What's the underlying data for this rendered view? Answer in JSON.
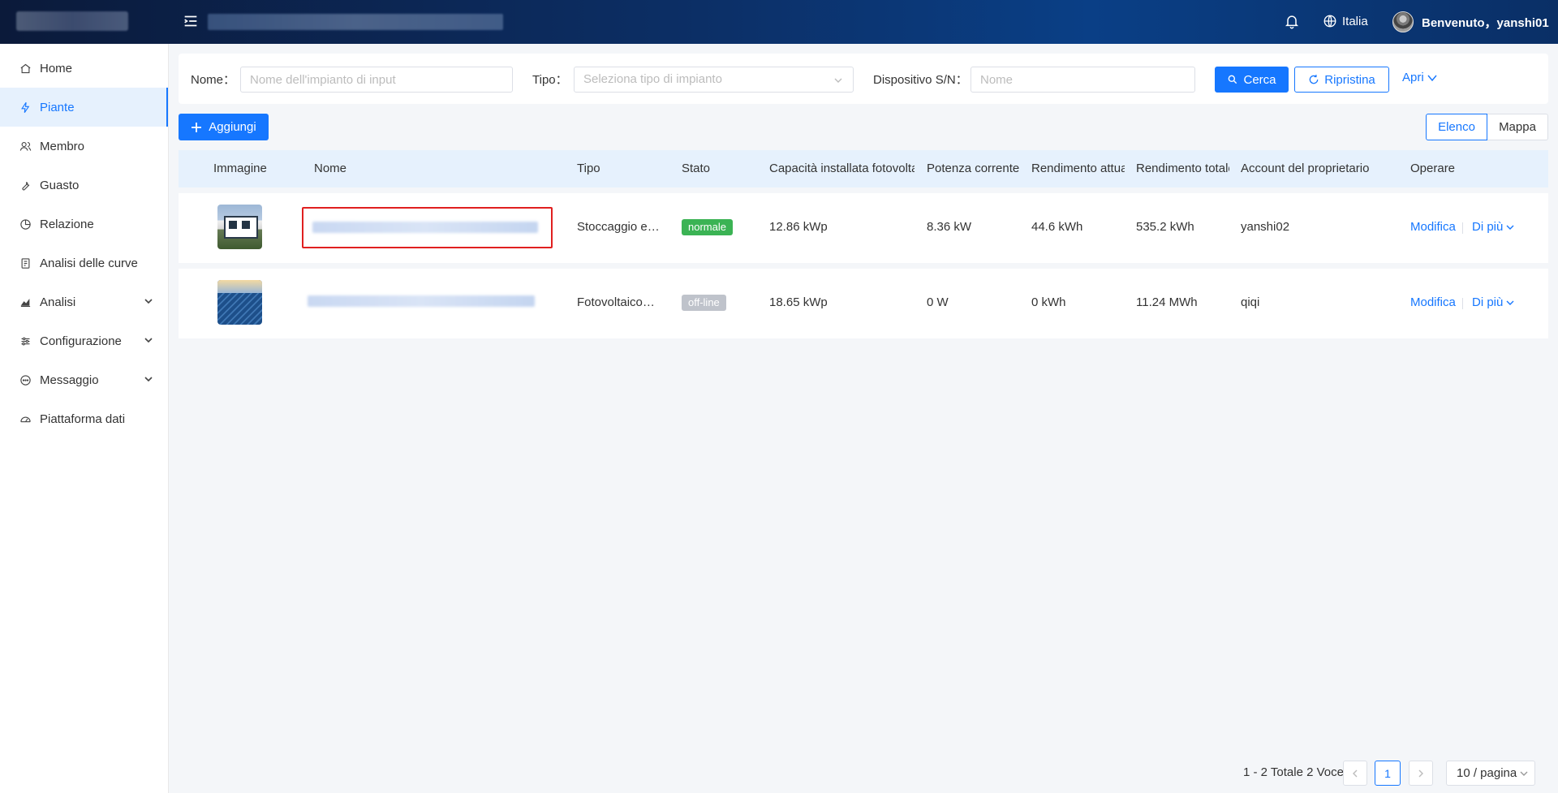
{
  "header": {
    "language": "Italia",
    "welcome": "Benvenuto，yanshi01"
  },
  "sidebar": {
    "items": [
      {
        "label": "Home",
        "icon": "home-icon"
      },
      {
        "label": "Piante",
        "icon": "lightning-icon",
        "active": true
      },
      {
        "label": "Membro",
        "icon": "users-icon"
      },
      {
        "label": "Guasto",
        "icon": "wrench-icon"
      },
      {
        "label": "Relazione",
        "icon": "pie-chart-icon"
      },
      {
        "label": "Analisi delle curve",
        "icon": "report-icon"
      },
      {
        "label": "Analisi",
        "icon": "area-chart-icon",
        "expandable": true
      },
      {
        "label": "Configurazione",
        "icon": "sliders-icon",
        "expandable": true
      },
      {
        "label": "Messaggio",
        "icon": "message-icon",
        "expandable": true
      },
      {
        "label": "Piattaforma dati",
        "icon": "dashboard-icon"
      }
    ]
  },
  "filter": {
    "name_label": "Nome",
    "name_placeholder": "Nome dell'impianto di input",
    "type_label": "Tipo",
    "type_placeholder": "Seleziona tipo di impianto",
    "sn_label": "Dispositivo S/N",
    "sn_placeholder": "Nome",
    "search_label": "Cerca",
    "reset_label": "Ripristina",
    "expand_label": "Apri"
  },
  "toolbar": {
    "add_label": "Aggiungi",
    "view_list": "Elenco",
    "view_map": "Mappa"
  },
  "table": {
    "columns": [
      "Immagine",
      "Nome",
      "Tipo",
      "Stato",
      "Capacità installata fotovoltaica",
      "Potenza corrente",
      "Rendimento attuale",
      "Rendimento totale",
      "Account del proprietario",
      "Operare"
    ],
    "rows": [
      {
        "type": "Stoccaggio e…",
        "status": "normale",
        "status_color": "#3bb354",
        "capacity": "12.86 kWp",
        "power": "8.36 kW",
        "current_yield": "44.6 kWh",
        "total_yield": "535.2 kWh",
        "owner": "yanshi02",
        "edit": "Modifica",
        "more": "Di più"
      },
      {
        "type": "Fotovoltaico…",
        "status": "off-line",
        "status_color": "#bfc3cb",
        "capacity": "18.65 kWp",
        "power": "0 W",
        "current_yield": "0 kWh",
        "total_yield": "11.24 MWh",
        "owner": "qiqi",
        "edit": "Modifica",
        "more": "Di più"
      }
    ]
  },
  "pagination": {
    "total_text": "1 - 2 Totale 2 Voce",
    "current_page": "1",
    "page_size": "10 / pagina"
  },
  "colors": {
    "accent": "#1677ff",
    "highlight": "#e02020"
  }
}
